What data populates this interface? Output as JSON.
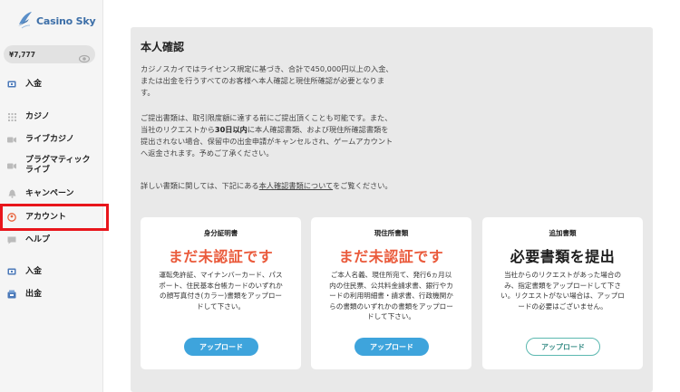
{
  "brand": {
    "name": "Casino Sky"
  },
  "balance": {
    "amount": "¥7,777"
  },
  "sidebar": {
    "items": [
      {
        "label": "入金"
      },
      {
        "label": "カジノ"
      },
      {
        "label": "ライブカジノ"
      },
      {
        "label": "プラグマティック ライブ"
      },
      {
        "label": "キャンペーン"
      },
      {
        "label": "アカウント"
      },
      {
        "label": "ヘルプ"
      },
      {
        "label": "入金"
      },
      {
        "label": "出金"
      }
    ]
  },
  "verification": {
    "title": "本人確認",
    "para1": "カジノスカイではライセンス規定に基づき、合計で450,000円以上の入金、または出金を行うすべてのお客様へ本人確認と現住所確認が必要となります。",
    "para2_a": "ご提出書類は、取引限度額に達する前にご提出頂くことも可能です。また、当社のリクエストから",
    "para2_bold": "30日以内",
    "para2_b": "に本人確認書類、および現住所確認書類を提出されない場合、保留中の出金申請がキャンセルされ、ゲームアカウントへ返金されます。予めご了承ください。",
    "para3_a": "詳しい書類に関しては、下記にある",
    "para3_link": "本人確認書類について",
    "para3_b": "をご覧ください。",
    "cards": [
      {
        "heading": "身分証明書",
        "status": "まだ未認証です",
        "description": "運転免許証、マイナンバーカード、パスポート、住民基本台帳カードのいずれかの顔写真付き(カラー)書類をアップロードして下さい。",
        "button": "アップロード"
      },
      {
        "heading": "現住所書類",
        "status": "まだ未認証です",
        "description": "ご本人名義、現住所宛て、発行6ヵ月以内の住民票、公共料金請求書、銀行やカードの利用明細書・請求書、行政機関からの書類のいずれかの書類をアップロードして下さい。",
        "button": "アップロード"
      },
      {
        "heading": "追加書類",
        "status": "必要書類を提出",
        "description": "当社からのリクエストがあった場合のみ、指定書類をアップロードして下さい。リクエストがない場合は、アップロードの必要はございません。",
        "button": "アップロード"
      }
    ]
  },
  "colors": {
    "accent_red": "#ea5a3b",
    "button_blue": "#3ea4dc",
    "outline_teal": "#5bb8b0",
    "highlight_box": "#e8151b"
  }
}
